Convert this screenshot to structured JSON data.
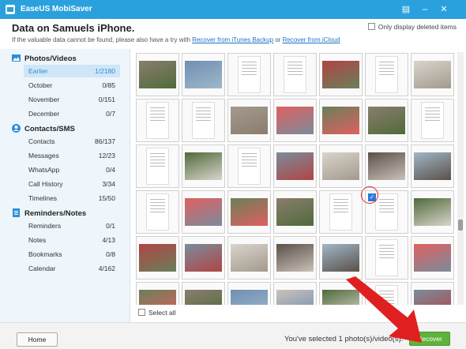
{
  "titlebar": {
    "title": "EaseUS MobiSaver"
  },
  "header": {
    "title": "Data on Samuels iPhone.",
    "subtitle_text": "If the valuable data cannot be found, please also have a try with",
    "link_itunes": "Recover from iTunes Backup",
    "or_text": "or",
    "link_icloud": "Recover from iCloud",
    "only_deleted_label": "Only display deleted items"
  },
  "sidebar": {
    "photos": {
      "label": "Photos/Videos",
      "icon": "photos-icon",
      "items": [
        {
          "label": "Earlier",
          "count": "1/2180",
          "selected": true
        },
        {
          "label": "October",
          "count": "0/85"
        },
        {
          "label": "November",
          "count": "0/151"
        },
        {
          "label": "December",
          "count": "0/7"
        }
      ]
    },
    "contacts": {
      "label": "Contacts/SMS",
      "icon": "contacts-icon",
      "items": [
        {
          "label": "Contacts",
          "count": "86/137"
        },
        {
          "label": "Messages",
          "count": "12/23"
        },
        {
          "label": "WhatsApp",
          "count": "0/4"
        },
        {
          "label": "Call History",
          "count": "3/34"
        },
        {
          "label": "Timelines",
          "count": "15/50"
        }
      ]
    },
    "reminders": {
      "label": "Reminders/Notes",
      "icon": "reminders-icon",
      "items": [
        {
          "label": "Reminders",
          "count": "0/1"
        },
        {
          "label": "Notes",
          "count": "4/13"
        },
        {
          "label": "Bookmarks",
          "count": "0/8"
        },
        {
          "label": "Calendar",
          "count": "4/162"
        }
      ]
    }
  },
  "grid": {
    "select_all_label": "Select all"
  },
  "footer": {
    "home_label": "Home",
    "status_text": "You've selected 1 photo(s)/video(s).",
    "recover_label": "Recover"
  },
  "colors": {
    "titlebar": "#2aa1dc",
    "accent": "#2a8fd6",
    "recover": "#5db33b",
    "annotation": "#e02020"
  }
}
